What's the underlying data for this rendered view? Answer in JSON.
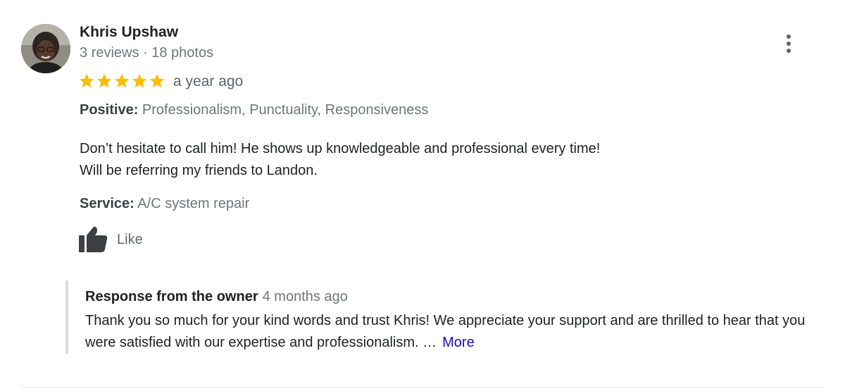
{
  "reviewer": {
    "name": "Khris Upshaw",
    "meta": "3 reviews · 18 photos"
  },
  "rating": {
    "stars": 5,
    "max_stars": 5,
    "date": "a year ago",
    "star_color": "#fbbc04"
  },
  "positive": {
    "key": "Positive:",
    "value": "Professionalism, Punctuality, Responsiveness"
  },
  "review_text": {
    "line1": "Don’t hesitate to call him! He shows up knowledgeable and professional every time!",
    "line2": "Will be referring my friends to Landon."
  },
  "service": {
    "key": "Service:",
    "value": "A/C system repair"
  },
  "actions": {
    "like_label": "Like"
  },
  "owner_response": {
    "title": "Response from the owner",
    "date": "4 months ago",
    "text": "Thank you so much for your kind words and trust Khris! We appreciate your support and are thrilled to hear that you were satisfied with our expertise and professionalism. …",
    "more_label": "More",
    "link_color": "#1a0dab"
  },
  "icons": {
    "avatar": "avatar",
    "more_options": "more-vert-icon",
    "star": "star-icon",
    "like": "thumbs-up-icon"
  }
}
